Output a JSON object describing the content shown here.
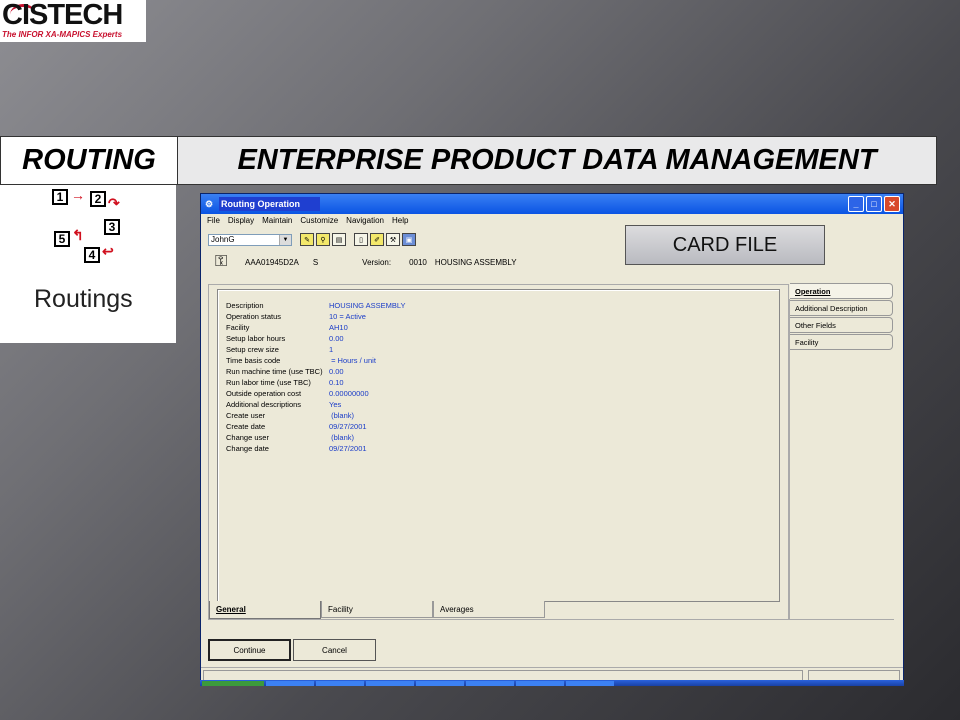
{
  "logo": {
    "brand": "CISTECH",
    "tagline": "The INFOR XA-MAPICS Experts"
  },
  "banner": {
    "left": "ROUTING",
    "right": "ENTERPRISE PRODUCT DATA MANAGEMENT"
  },
  "routings_panel": {
    "label": "Routings",
    "steps": [
      "1",
      "2",
      "3",
      "4",
      "5"
    ]
  },
  "window": {
    "title": "Routing Operation",
    "menu": [
      "File",
      "Display",
      "Maintain",
      "Customize",
      "Navigation",
      "Help"
    ],
    "user_combo": "JohnG",
    "info": {
      "item": "AAA01945D2A",
      "code": "S",
      "version_label": "Version:",
      "version_value": "0010",
      "version_desc": "HOUSING ASSEMBLY"
    },
    "fields": [
      {
        "label": "Description",
        "value": "HOUSING ASSEMBLY"
      },
      {
        "label": "Operation status",
        "value": "10 = Active"
      },
      {
        "label": "Facility",
        "value": "AH10"
      },
      {
        "label": "Setup labor hours",
        "value": "0.00"
      },
      {
        "label": "Setup crew size",
        "value": "1"
      },
      {
        "label": "Time basis code",
        "value": " = Hours / unit"
      },
      {
        "label": "Run machine time (use TBC)",
        "value": "0.00"
      },
      {
        "label": "Run labor time (use TBC)",
        "value": "0.10"
      },
      {
        "label": "Outside operation cost",
        "value": "0.00000000"
      },
      {
        "label": "Additional descriptions",
        "value": "Yes"
      },
      {
        "label": "Create user",
        "value": " (blank)"
      },
      {
        "label": "Create date",
        "value": "09/27/2001"
      },
      {
        "label": "Change user",
        "value": " (blank)"
      },
      {
        "label": "Change date",
        "value": "09/27/2001"
      }
    ],
    "bottom_tabs": [
      "General",
      "Facility",
      "Averages"
    ],
    "right_tabs": [
      "Operation",
      "Additional Description",
      "Other Fields",
      "Facility"
    ],
    "buttons": {
      "continue": "Continue",
      "cancel": "Cancel"
    }
  },
  "card_file": "CARD FILE"
}
